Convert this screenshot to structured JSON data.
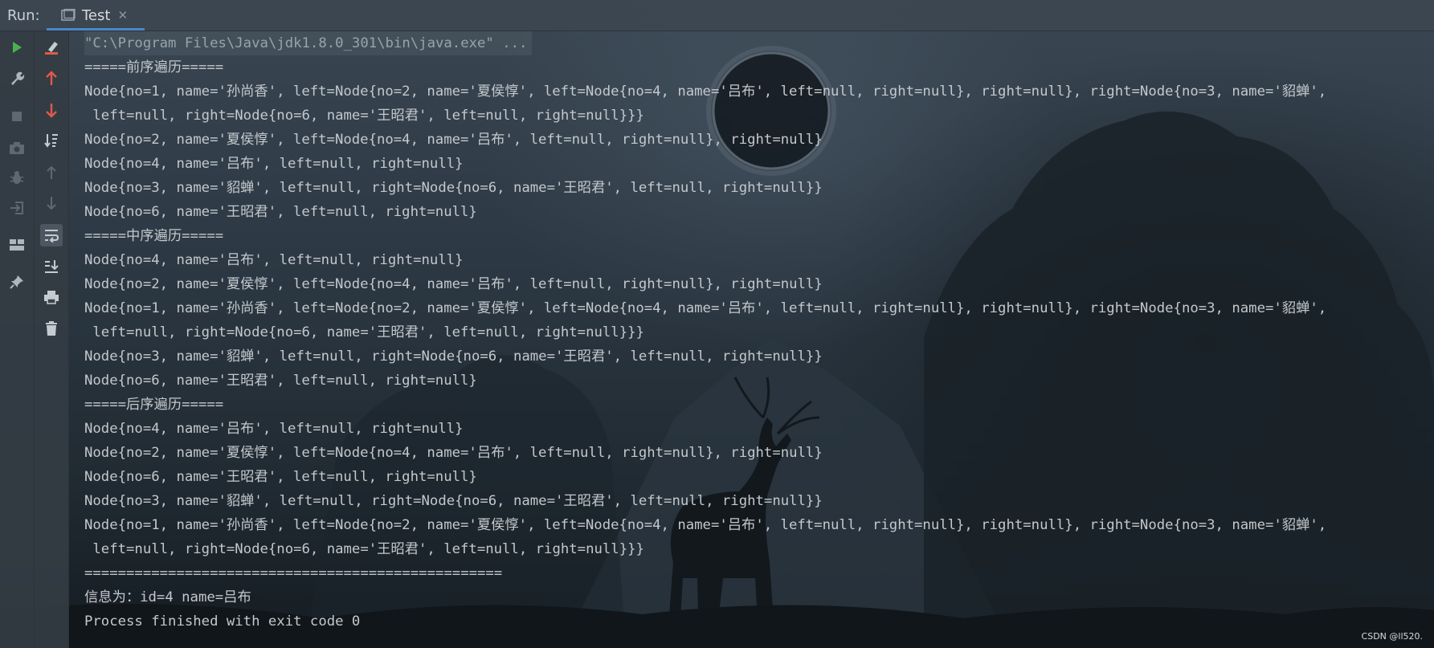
{
  "run_bar": {
    "label": "Run:",
    "tab_title": "Test",
    "tab_close": "✕"
  },
  "toolbar_left": [
    {
      "name": "run-icon",
      "color": "#4caf50"
    },
    {
      "name": "wrench-icon"
    },
    {
      "name": "stop-icon"
    },
    {
      "name": "camera-icon"
    },
    {
      "name": "bug-icon"
    },
    {
      "name": "login-icon"
    },
    {
      "name": "layout-icon"
    },
    {
      "name": "pin-icon"
    }
  ],
  "toolbar_right": [
    {
      "name": "clear-icon"
    },
    {
      "name": "up-arrow-icon",
      "color": "#e05a4a"
    },
    {
      "name": "down-arrow-icon",
      "color": "#e05a4a"
    },
    {
      "name": "sort-icon"
    },
    {
      "name": "up-icon"
    },
    {
      "name": "down-icon"
    },
    {
      "name": "soft-wrap-icon"
    },
    {
      "name": "scroll-to-end-icon"
    },
    {
      "name": "print-icon"
    },
    {
      "name": "trash-icon"
    }
  ],
  "console": {
    "lines": [
      "\"C:\\Program Files\\Java\\jdk1.8.0_301\\bin\\java.exe\" ...",
      "=====前序遍历=====",
      "Node{no=1, name='孙尚香', left=Node{no=2, name='夏侯惇', left=Node{no=4, name='吕布', left=null, right=null}, right=null}, right=Node{no=3, name='貂蝉',",
      " left=null, right=Node{no=6, name='王昭君', left=null, right=null}}}",
      "Node{no=2, name='夏侯惇', left=Node{no=4, name='吕布', left=null, right=null}, right=null}",
      "Node{no=4, name='吕布', left=null, right=null}",
      "Node{no=3, name='貂蝉', left=null, right=Node{no=6, name='王昭君', left=null, right=null}}",
      "Node{no=6, name='王昭君', left=null, right=null}",
      "=====中序遍历=====",
      "Node{no=4, name='吕布', left=null, right=null}",
      "Node{no=2, name='夏侯惇', left=Node{no=4, name='吕布', left=null, right=null}, right=null}",
      "Node{no=1, name='孙尚香', left=Node{no=2, name='夏侯惇', left=Node{no=4, name='吕布', left=null, right=null}, right=null}, right=Node{no=3, name='貂蝉',",
      " left=null, right=Node{no=6, name='王昭君', left=null, right=null}}}",
      "Node{no=3, name='貂蝉', left=null, right=Node{no=6, name='王昭君', left=null, right=null}}",
      "Node{no=6, name='王昭君', left=null, right=null}",
      "=====后序遍历=====",
      "Node{no=4, name='吕布', left=null, right=null}",
      "Node{no=2, name='夏侯惇', left=Node{no=4, name='吕布', left=null, right=null}, right=null}",
      "Node{no=6, name='王昭君', left=null, right=null}",
      "Node{no=3, name='貂蝉', left=null, right=Node{no=6, name='王昭君', left=null, right=null}}",
      "Node{no=1, name='孙尚香', left=Node{no=2, name='夏侯惇', left=Node{no=4, name='吕布', left=null, right=null}, right=null}, right=Node{no=3, name='貂蝉',",
      " left=null, right=Node{no=6, name='王昭君', left=null, right=null}}}",
      "==================================================",
      "信息为：id=4 name=吕布",
      "Process finished with exit code 0"
    ]
  },
  "watermark": "CSDN @ll520."
}
